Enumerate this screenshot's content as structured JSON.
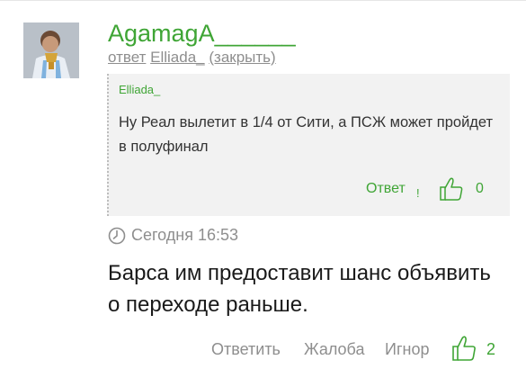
{
  "comment": {
    "author": "AgamagA______",
    "reply_prefix": "ответ",
    "reply_to": "Elliada_",
    "close_label": "(закрыть)",
    "quote": {
      "author": "Elliada_",
      "text": "Ну Реал вылетит в 1/4 от Сити, а ПСЖ может пройдет в полуфинал",
      "reply_label": "Ответ",
      "separator": "!",
      "likes": "0"
    },
    "timestamp": "Сегодня 16:53",
    "text": "Барса им предоставит шанс объявить о переходе раньше.",
    "actions": {
      "reply": "Ответить",
      "report": "Жалоба",
      "ignore": "Игнор",
      "likes": "2"
    }
  },
  "colors": {
    "accent": "#3fa535",
    "muted": "#8e8e8e",
    "quote_bg": "#f2f2f2"
  },
  "icons": {
    "avatar": "user-avatar",
    "clock": "clock-icon",
    "like": "thumbs-up-icon"
  }
}
